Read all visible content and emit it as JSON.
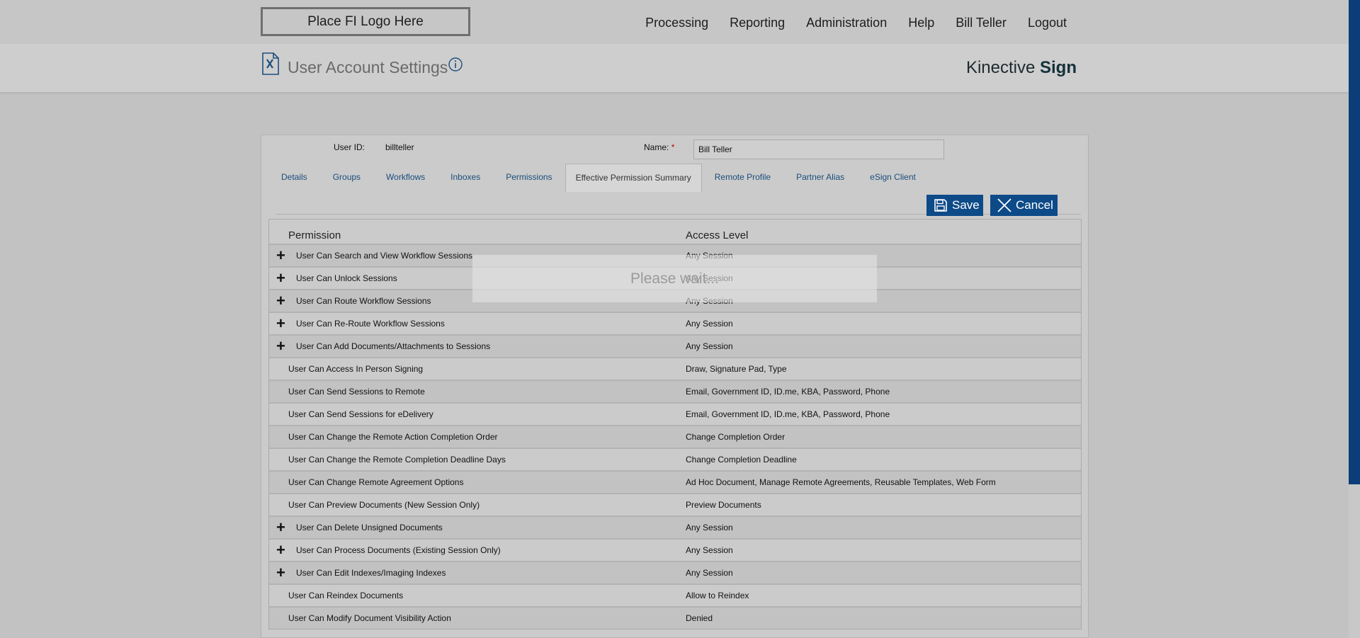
{
  "header": {
    "logo_text": "Place FI Logo Here",
    "nav": [
      "Processing",
      "Reporting",
      "Administration",
      "Help",
      "Bill Teller",
      "Logout"
    ]
  },
  "subheader": {
    "title": "User Account Settings",
    "brand_light": "Kinective ",
    "brand_bold": "Sign"
  },
  "user": {
    "user_id_label": "User ID:",
    "user_id": "billteller",
    "name_label": "Name:",
    "required_mark": "*",
    "name_value": "Bill Teller"
  },
  "tabs": [
    {
      "label": "Details",
      "active": false
    },
    {
      "label": "Groups",
      "active": false
    },
    {
      "label": "Workflows",
      "active": false
    },
    {
      "label": "Inboxes",
      "active": false
    },
    {
      "label": "Permissions",
      "active": false
    },
    {
      "label": "Effective Permission Summary",
      "active": true
    },
    {
      "label": "Remote Profile",
      "active": false
    },
    {
      "label": "Partner Alias",
      "active": false
    },
    {
      "label": "eSign Client",
      "active": false
    }
  ],
  "actions": {
    "save_label": "Save",
    "cancel_label": "Cancel"
  },
  "grid": {
    "col_permission": "Permission",
    "col_access": "Access Level",
    "rows": [
      {
        "permission": "User Can Search and View Workflow Sessions",
        "access": "Any Session",
        "expandable": true
      },
      {
        "permission": "User Can Unlock Sessions",
        "access": "Any Session",
        "expandable": true
      },
      {
        "permission": "User Can Route Workflow Sessions",
        "access": "Any Session",
        "expandable": true
      },
      {
        "permission": "User Can Re-Route Workflow Sessions",
        "access": "Any Session",
        "expandable": true
      },
      {
        "permission": "User Can Add Documents/Attachments to Sessions",
        "access": "Any Session",
        "expandable": true
      },
      {
        "permission": "User Can Access In Person Signing",
        "access": "Draw, Signature Pad, Type",
        "expandable": false
      },
      {
        "permission": "User Can Send Sessions to Remote",
        "access": "Email, Government ID, ID.me, KBA, Password, Phone",
        "expandable": false
      },
      {
        "permission": "User Can Send Sessions for eDelivery",
        "access": "Email, Government ID, ID.me, KBA, Password, Phone",
        "expandable": false
      },
      {
        "permission": "User Can Change the Remote Action Completion Order",
        "access": "Change Completion Order",
        "expandable": false
      },
      {
        "permission": "User Can Change the Remote Completion Deadline Days",
        "access": "Change Completion Deadline",
        "expandable": false
      },
      {
        "permission": "User Can Change Remote Agreement Options",
        "access": "Ad Hoc Document, Manage Remote Agreements, Reusable Templates, Web Form",
        "expandable": false
      },
      {
        "permission": "User Can Preview Documents (New Session Only)",
        "access": "Preview Documents",
        "expandable": false
      },
      {
        "permission": "User Can Delete Unsigned Documents",
        "access": "Any Session",
        "expandable": true
      },
      {
        "permission": "User Can Process Documents (Existing Session Only)",
        "access": "Any Session",
        "expandable": true
      },
      {
        "permission": "User Can Edit Indexes/Imaging Indexes",
        "access": "Any Session",
        "expandable": true
      },
      {
        "permission": "User Can Reindex Documents",
        "access": "Allow to Reindex",
        "expandable": false
      },
      {
        "permission": "User Can Modify Document Visibility Action",
        "access": "Denied",
        "expandable": false
      }
    ]
  },
  "overlay": {
    "text": "Please wait..."
  },
  "colors": {
    "accent": "#0d4a88",
    "link": "#1a4d7c",
    "scroll_thumb": "#0c3d78",
    "required": "#c00000"
  }
}
